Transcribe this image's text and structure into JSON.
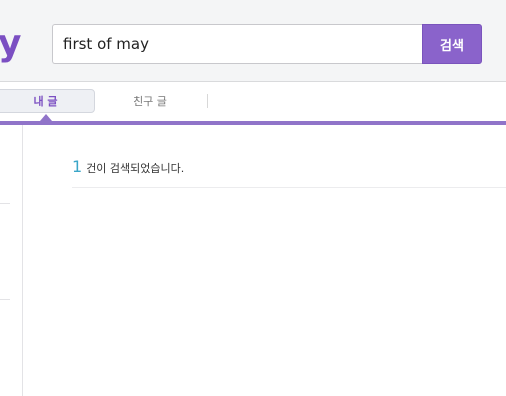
{
  "header": {
    "logo_text": "y",
    "search": {
      "value": "first of may",
      "button_label": "검색"
    }
  },
  "tabs": [
    {
      "label": "내 글",
      "active": true
    },
    {
      "label": "친구 글",
      "active": false
    }
  ],
  "results": {
    "count": "1",
    "message": "건이 검색되었습니다."
  },
  "colors": {
    "brand": "#7b4fc2",
    "accent_bar": "#9074c9",
    "count": "#3aa6c8"
  }
}
